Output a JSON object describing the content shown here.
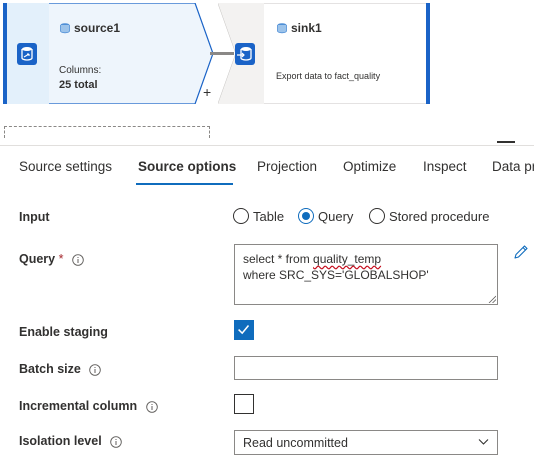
{
  "flow": {
    "source_node": {
      "title": "source1",
      "columns_label": "Columns:",
      "columns_value": "25 total"
    },
    "sink_node": {
      "title": "sink1",
      "description": "Export data to fact_quality"
    },
    "add_label": "+"
  },
  "tabs": [
    {
      "label": "Source settings"
    },
    {
      "label": "Source options"
    },
    {
      "label": "Projection"
    },
    {
      "label": "Optimize"
    },
    {
      "label": "Inspect"
    },
    {
      "label": "Data pr"
    }
  ],
  "form": {
    "input": {
      "label": "Input",
      "options": [
        "Table",
        "Query",
        "Stored procedure"
      ],
      "selected": "Query"
    },
    "query": {
      "label": "Query",
      "required_mark": "*",
      "line1_prefix": "select * from ",
      "line1_table": "quality_temp",
      "line2": "where SRC_SYS='GLOBALSHOP'"
    },
    "enable_staging": {
      "label": "Enable staging",
      "checked": true
    },
    "batch_size": {
      "label": "Batch size",
      "value": ""
    },
    "incremental_column": {
      "label": "Incremental column",
      "checked": false
    },
    "isolation_level": {
      "label": "Isolation level",
      "value": "Read uncommitted"
    }
  },
  "colors": {
    "accent": "#0f6cbd",
    "node_blue": "#1a63c7",
    "required": "#a4262c"
  }
}
